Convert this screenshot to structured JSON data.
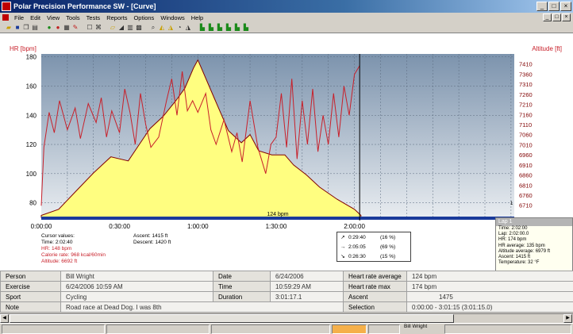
{
  "window": {
    "title": "Polar Precision Performance SW - [Curve]",
    "minimize": "_",
    "maximize": "□",
    "close": "×"
  },
  "menu": [
    "File",
    "Edit",
    "View",
    "Tools",
    "Tests",
    "Reports",
    "Options",
    "Windows",
    "Help"
  ],
  "toolbar_icons": [
    "open-folder-icon",
    "save-icon",
    "copy-icon",
    "print-icon",
    "globe-icon",
    "heart-icon",
    "calendar-icon",
    "note-icon",
    "edit-icon",
    "bike-icon",
    "folder-chart-icon",
    "zoom-icon",
    "bar-chart-icon",
    "grid-icon",
    "zoom-in-icon",
    "zoom-out-icon",
    "scale-icon",
    "pie-icon",
    "curve-icon",
    "curve-hr-icon",
    "curve-alt-icon",
    "curve-speed-icon",
    "curve-cadence-icon",
    "curve-power-icon"
  ],
  "colors": {
    "hr_line": "#c8202a",
    "altitude_fill": "#fffe80",
    "altitude_line": "#800000",
    "bg_top": "#8096b0",
    "bg_bottom": "#e2e8ee",
    "baseline": "#1a3a9a"
  },
  "chart_data": {
    "type": "line",
    "title": "",
    "y_left_label": "HR [bpm]",
    "y_right_label": "Altitude [ft]",
    "y_left_ticks": [
      80,
      100,
      120,
      140,
      160,
      180
    ],
    "y_left_range": [
      70,
      182
    ],
    "y_right_ticks": [
      6710,
      6760,
      6810,
      6860,
      6910,
      6960,
      7010,
      7060,
      7110,
      7160,
      7210,
      7260,
      7310,
      7360,
      7410
    ],
    "y_right_range": [
      6650,
      7460
    ],
    "x_ticks": [
      "0:00:00",
      "0:30:00",
      "1:00:00",
      "1:30:00",
      "2:00:00"
    ],
    "x_tick_seconds": [
      0,
      1800,
      3600,
      5400,
      7200
    ],
    "x_range_seconds": [
      0,
      10875
    ],
    "limit_label": "124 bpm",
    "limit_value": 124,
    "cursor_time_seconds": 7320,
    "series": [
      {
        "name": "HR",
        "x_seconds": [
          0,
          60,
          180,
          300,
          420,
          600,
          780,
          900,
          1080,
          1260,
          1380,
          1500,
          1620,
          1800,
          1920,
          2040,
          2160,
          2280,
          2400,
          2520,
          2700,
          2880,
          3000,
          3120,
          3240,
          3360,
          3480,
          3600,
          3780,
          3900,
          4020,
          4200,
          4380,
          4500,
          4620,
          4800,
          4980,
          5160,
          5280,
          5400,
          5520,
          5640,
          5760,
          5880,
          6000,
          6120,
          6240,
          6360,
          6480,
          6600,
          6720,
          6840,
          6960,
          7080,
          7200,
          7320
        ],
        "values": [
          78,
          118,
          142,
          128,
          150,
          130,
          145,
          124,
          148,
          135,
          152,
          125,
          143,
          128,
          158,
          142,
          120,
          155,
          134,
          118,
          125,
          150,
          165,
          140,
          170,
          143,
          150,
          142,
          155,
          130,
          120,
          137,
          115,
          128,
          108,
          150,
          118,
          100,
          120,
          125,
          155,
          118,
          165,
          110,
          150,
          120,
          158,
          115,
          140,
          120,
          155,
          125,
          160,
          140,
          168,
          174
        ]
      },
      {
        "name": "Altitude",
        "x_seconds": [
          0,
          400,
          800,
          1200,
          1600,
          2000,
          2250,
          2500,
          2800,
          3100,
          3300,
          3500,
          3600,
          3700,
          4000,
          4300,
          4600,
          4800,
          5000,
          5300,
          5600,
          5800,
          6100,
          6400,
          6800,
          7200,
          7350
        ],
        "values": [
          6660,
          6690,
          6780,
          6870,
          6950,
          6930,
          7010,
          7090,
          7150,
          7230,
          7290,
          7390,
          7430,
          7380,
          7230,
          7080,
          7020,
          7060,
          6980,
          6960,
          6960,
          6910,
          6860,
          6800,
          6740,
          6690,
          6660
        ]
      }
    ]
  },
  "cursor_values": {
    "header": "Cursor values:",
    "time": "Time: 2:02:40",
    "hr": "HR: 148 bpm",
    "calorie": "Calorie rate: 968 kcal/60min",
    "altitude": "Altitude: 6692 ft"
  },
  "ascent_descent": {
    "ascent": "Ascent: 1415 ft",
    "descent": "Descent: 1420 ft"
  },
  "zones": [
    {
      "arrow": "↗",
      "time": "0:29:40",
      "pct": "(16 %)"
    },
    {
      "arrow": "→",
      "time": "2:05:05",
      "pct": "(69 %)"
    },
    {
      "arrow": "↘",
      "time": "0:26:30",
      "pct": "(15 %)"
    }
  ],
  "lap": {
    "title": "Lap 1",
    "time": "Time: 2:02:00",
    "lap": "Lap: 2:02:00.0",
    "hr": "HR: 174 bpm",
    "hr_avg": "HR average:   135 bpm",
    "alt_avg": "Altitude average:   6979 ft",
    "ascent": "Ascent: 1415 ft",
    "temp": "Temperature: 32 °F",
    "side_mark": "1"
  },
  "info": [
    [
      "Person",
      "Bill Wright",
      "Date",
      "6/24/2006",
      "Heart rate average",
      "124 bpm"
    ],
    [
      "Exercise",
      "6/24/2006 10:59 AM",
      "Time",
      "10:59:29 AM",
      "Heart rate max",
      "174 bpm"
    ],
    [
      "Sport",
      "Cycling",
      "Duration",
      "3:01:17.1",
      "Ascent",
      "1475"
    ],
    [
      "Note",
      "Road race at Dead Dog. I was 8th",
      "",
      "",
      "Selection",
      "0:00:00 - 3:01:15 (3:01:15.0)"
    ]
  ],
  "status": {
    "person": "Bill Wright"
  }
}
